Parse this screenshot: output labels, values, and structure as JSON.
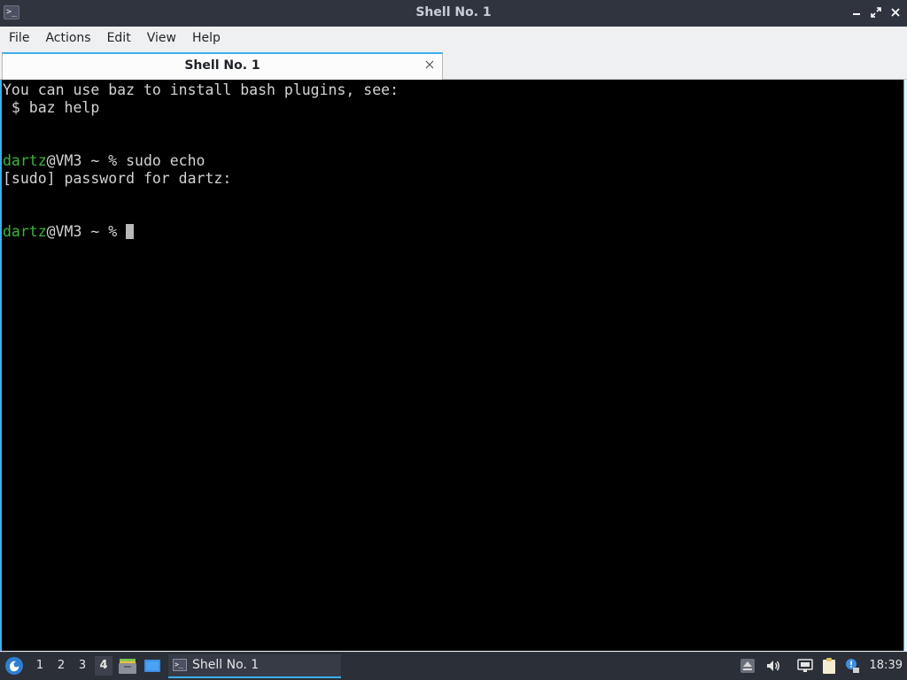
{
  "window": {
    "title": "Shell No. 1",
    "icon": "terminal-icon"
  },
  "menu": [
    {
      "label": "File"
    },
    {
      "label": "Actions"
    },
    {
      "label": "Edit"
    },
    {
      "label": "View"
    },
    {
      "label": "Help"
    }
  ],
  "tabs": [
    {
      "label": "Shell No. 1",
      "active": true
    }
  ],
  "terminal": {
    "lines": [
      {
        "text": "You can use baz to install bash plugins, see:"
      },
      {
        "text": " $ baz help"
      },
      {
        "text": ""
      },
      {
        "user": "dartz",
        "rest": "@VM3 ~ % ",
        "command": "sudo echo"
      },
      {
        "text": "[sudo] password for dartz:"
      },
      {
        "text": ""
      },
      {
        "user": "dartz",
        "rest": "@VM3 ~ % ",
        "command": ""
      }
    ],
    "colors": {
      "background": "#000000",
      "foreground": "#d3d3d3",
      "user": "#3cb539",
      "accent": "#3daee9"
    }
  },
  "taskbar": {
    "desktops": [
      "1",
      "2",
      "3",
      "4"
    ],
    "active_desktop": "4",
    "tasks": [
      {
        "label": "Shell No. 1"
      }
    ],
    "clock": "18:39",
    "tray_icons": [
      "eject-icon",
      "volume-icon",
      "network-icon",
      "clipboard-icon",
      "notification-icon"
    ]
  }
}
